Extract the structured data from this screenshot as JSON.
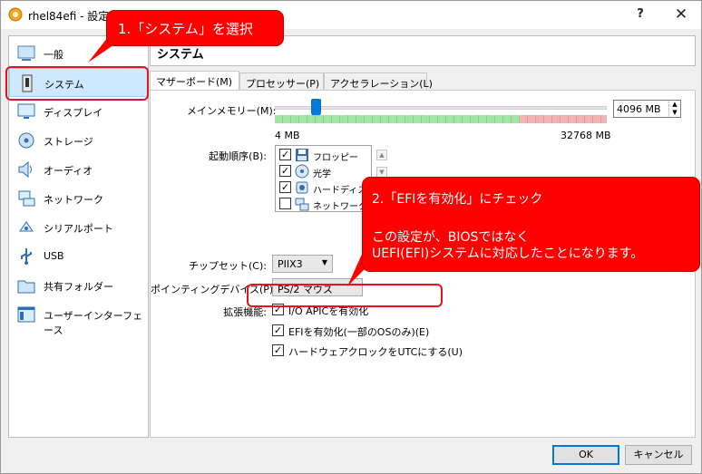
{
  "window": {
    "title": "rhel84efi - 設定",
    "help": "?",
    "close": "✕"
  },
  "sidebar": {
    "items": [
      {
        "label": "一般",
        "icon": "general-icon"
      },
      {
        "label": "システム",
        "icon": "system-icon",
        "selected": true
      },
      {
        "label": "ディスプレイ",
        "icon": "display-icon"
      },
      {
        "label": "ストレージ",
        "icon": "storage-icon"
      },
      {
        "label": "オーディオ",
        "icon": "audio-icon"
      },
      {
        "label": "ネットワーク",
        "icon": "network-icon"
      },
      {
        "label": "シリアルポート",
        "icon": "serial-port-icon"
      },
      {
        "label": "USB",
        "icon": "usb-icon"
      },
      {
        "label": "共有フォルダー",
        "icon": "shared-folder-icon"
      },
      {
        "label": "ユーザーインターフェース",
        "icon": "user-interface-icon"
      }
    ]
  },
  "section": {
    "title": "システム"
  },
  "tabs": [
    {
      "label": "マザーボード(M)",
      "active": true
    },
    {
      "label": "プロセッサー(P)"
    },
    {
      "label": "アクセラレーション(L)"
    }
  ],
  "motherboard": {
    "memory_label": "メインメモリー(M):",
    "memory_value": "4096 MB",
    "memory_min": "4 MB",
    "memory_max": "32768 MB",
    "memory_fraction": 0.125,
    "boot_label": "起動順序(B):",
    "boot_items": [
      {
        "label": "フロッピー",
        "checked": true,
        "icon": "floppy-icon"
      },
      {
        "label": "光学",
        "checked": true,
        "icon": "optical-disc-icon"
      },
      {
        "label": "ハードディスク",
        "checked": true,
        "icon": "hard-disk-icon"
      },
      {
        "label": "ネットワーク",
        "checked": false,
        "icon": "network-boot-icon"
      }
    ],
    "chipset_label": "チップセット(C):",
    "chipset_value": "PIIX3",
    "pointing_label": "ポインティングデバイス(P):",
    "pointing_value": "PS/2 マウス",
    "ext_label": "拡張機能:",
    "ioapic_label": "I/O APICを有効化",
    "efi_label": "EFIを有効化(一部のOSのみ)(E)",
    "utc_label": "ハードウェアクロックをUTCにする(U)"
  },
  "callouts": {
    "step1": "1.「システム」を選択",
    "step2_title": "2.「EFIを有効化」にチェック",
    "step2_line1": "この設定が、BIOSではなく",
    "step2_line2": "UEFI(EFI)システムに対応したことになります。"
  },
  "buttons": {
    "ok": "OK",
    "cancel": "キャンセル"
  },
  "colors": {
    "highlight": "#e81123",
    "callout": "#ff0000",
    "selection": "#cde8ff",
    "accent": "#0078d7"
  }
}
